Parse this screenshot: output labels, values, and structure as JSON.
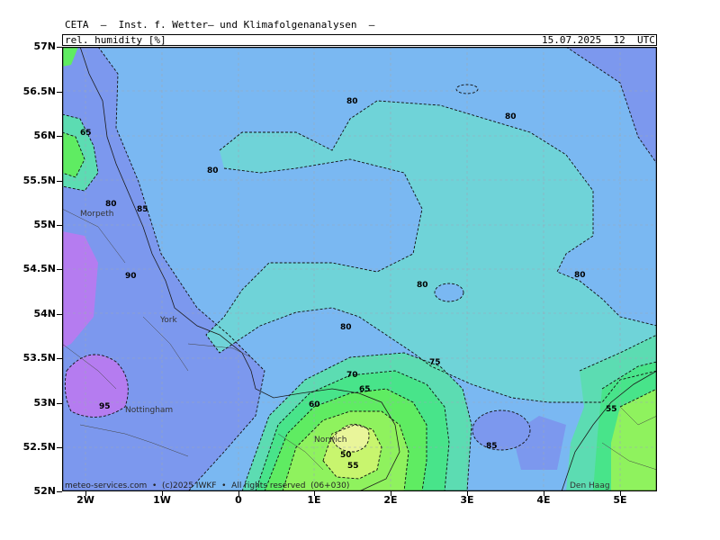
{
  "header": {
    "title": "CETA  —  Inst. f. Wetter— und Klimafolgenanalysen  —",
    "variable": "rel. humidity [%]",
    "datetime": "15.07.2025  12  UTC"
  },
  "axes": {
    "lat_labels": [
      "57N",
      "56.5N",
      "56N",
      "55.5N",
      "55N",
      "54.5N",
      "54N",
      "53.5N",
      "53N",
      "52.5N",
      "52N"
    ],
    "lon_labels": [
      "2W",
      "1W",
      "0",
      "1E",
      "2E",
      "3E",
      "4E",
      "5E"
    ]
  },
  "cities": [
    "Morpeth",
    "York",
    "Nottingham",
    "Norwich",
    "Den Haag"
  ],
  "contour_labels": [
    "65",
    "80",
    "85",
    "80",
    "90",
    "80",
    "80",
    "80",
    "80",
    "75",
    "70",
    "65",
    "60",
    "95",
    "50",
    "55",
    "85",
    "80",
    "55"
  ],
  "footer": "meteo-services.com  •  (c)2025 IWKF  •  All rights reserved  (06+030)",
  "colors": {
    "h50": "#e9f59a",
    "h55": "#c8f56e",
    "h60": "#8ff25e",
    "h65": "#5fec62",
    "h70": "#48e48a",
    "h75": "#5cdcb2",
    "h80": "#6fd3d8",
    "h85": "#7ab8f2",
    "h90": "#7c98ee",
    "h95": "#9a7ff0",
    "h100": "#b57cf0"
  }
}
